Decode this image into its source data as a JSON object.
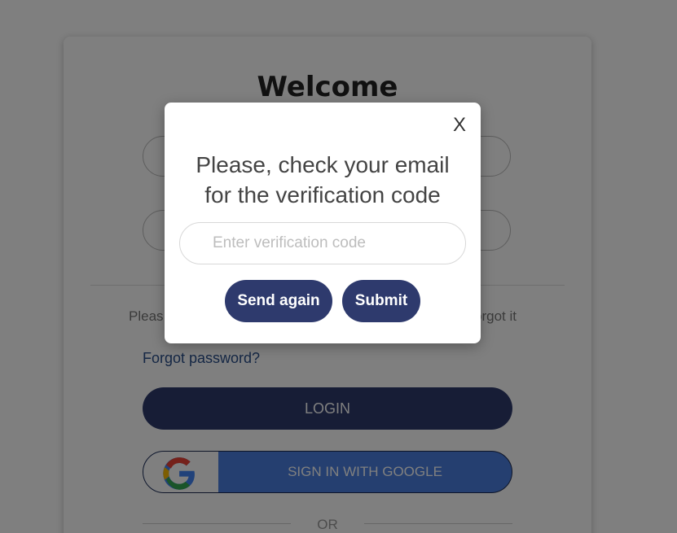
{
  "login": {
    "title": "Welcome",
    "hint_left": "Pleas",
    "hint_right": "orgot it",
    "forgot_link": "Forgot password?",
    "login_button": "LOGIN",
    "google_button": "SIGN IN WITH GOOGLE",
    "or_text": "OR"
  },
  "modal": {
    "close_label": "X",
    "message_line1": "Please, check your email",
    "message_line2": "for the verification code",
    "input_placeholder": "Enter verification code",
    "send_again_label": "Send again",
    "submit_label": "Submit"
  },
  "colors": {
    "primary": "#2e3a6d",
    "google_blue": "#4a7fe0",
    "link": "#2a4f8a"
  },
  "icons": {
    "google": "google-logo-icon"
  }
}
